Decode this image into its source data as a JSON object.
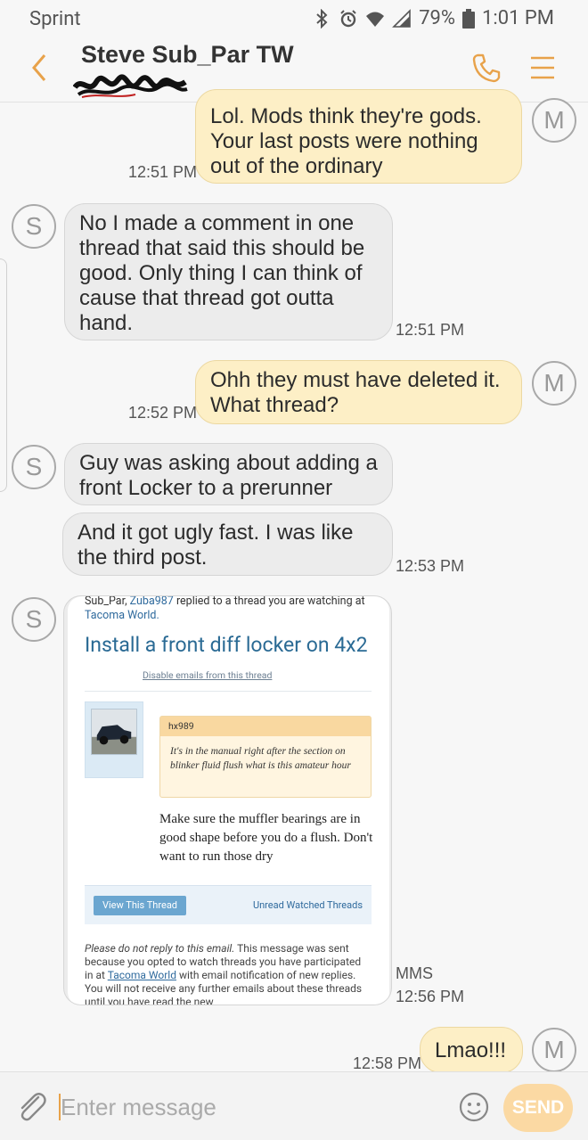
{
  "status": {
    "carrier": "Sprint",
    "battery": "79%",
    "clock": "1:01 PM"
  },
  "header": {
    "contact_name": "Steve Sub_Par TW"
  },
  "messages": [
    {
      "text": "Lol. Mods think they're gods. Your last posts were nothing out of the ordinary",
      "time": "12:51 PM",
      "avatar": "M"
    },
    {
      "text": "No I made a comment in one thread that said this should be good. Only thing I can think of cause that thread got outta hand.",
      "time": "12:51 PM",
      "avatar": "S"
    },
    {
      "text": "Ohh they must have deleted it. What thread?",
      "time": "12:52 PM",
      "avatar": "M"
    },
    {
      "text": "Guy was asking about adding a front Locker to a prerunner",
      "avatar": "S"
    },
    {
      "text": "And it got ugly fast. I was like the third post.",
      "time": "12:53 PM"
    },
    {
      "time": "12:56 PM",
      "type_label": "MMS",
      "avatar": "S"
    },
    {
      "text": "Lmao!!!",
      "time": "12:58 PM",
      "avatar": "M"
    }
  ],
  "mms": {
    "intro_name": "Sub_Par,",
    "intro_user": "Zuba987",
    "intro_text": "replied to a thread you are watching at",
    "intro_site": "Tacoma World.",
    "thread_title": "Install a front diff locker on 4x2",
    "disable_link": "Disable emails from this thread",
    "quote_author": "hx989",
    "quote_text": "It's in the manual right after the section on blinker fluid flush what is this amateur hour",
    "reply_text": "Make sure the muffler bearings are in good shape before you do a flush. Don't want to run those dry",
    "view_button": "View This Thread",
    "unread_link": "Unread Watched Threads",
    "footer_italic": "Please do not reply to this email.",
    "footer_text_1": "This message was sent because you opted to watch threads you have participated in at",
    "footer_site": "Tacoma World",
    "footer_text_2": "with email notification of new replies. You will not receive any further emails about these threads until you have read the new"
  },
  "composer": {
    "placeholder": "Enter message",
    "send_label": "SEND"
  },
  "colors": {
    "accent": "#e8a24a",
    "outgoing_bubble": "#fdefc6",
    "incoming_bubble": "#ececec"
  }
}
